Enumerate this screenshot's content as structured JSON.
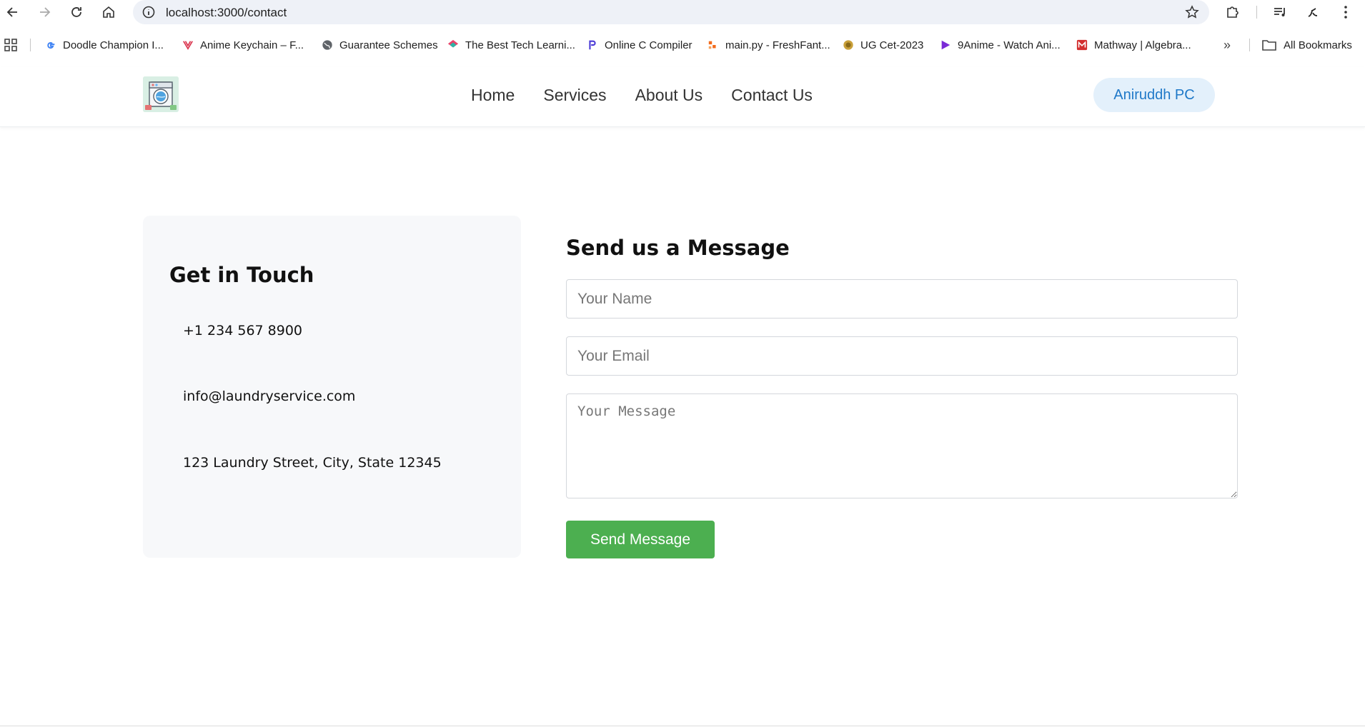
{
  "browser": {
    "url": "localhost:3000/contact",
    "bookmarks": [
      {
        "label": "Doodle Champion I...",
        "icon": "google-icon"
      },
      {
        "label": "Anime Keychain – F...",
        "icon": "anime-keychain-icon"
      },
      {
        "label": "Guarantee Schemes",
        "icon": "globe-icon"
      },
      {
        "label": "The Best Tech Learni...",
        "icon": "tech-learning-icon"
      },
      {
        "label": "Online C Compiler",
        "icon": "compiler-icon"
      },
      {
        "label": "main.py - FreshFant...",
        "icon": "freshfantasy-icon"
      },
      {
        "label": "UG Cet-2023",
        "icon": "emblem-icon"
      },
      {
        "label": "9Anime - Watch Ani...",
        "icon": "play-icon"
      },
      {
        "label": "Mathway | Algebra...",
        "icon": "mathway-icon"
      }
    ],
    "all_bookmarks_label": "All Bookmarks"
  },
  "header": {
    "nav": [
      "Home",
      "Services",
      "About Us",
      "Contact Us"
    ],
    "user_name": "Aniruddh PC"
  },
  "info": {
    "title": "Get in Touch",
    "phone": "+1 234 567 8900",
    "email": "info@laundryservice.com",
    "address": "123 Laundry Street, City, State 12345"
  },
  "form": {
    "title": "Send us a Message",
    "name_placeholder": "Your Name",
    "email_placeholder": "Your Email",
    "message_placeholder": "Your Message",
    "submit_label": "Send Message"
  },
  "colors": {
    "accent_button": "#4caf50",
    "user_pill_bg": "#e3f0fb",
    "user_pill_text": "#1e78c8"
  }
}
